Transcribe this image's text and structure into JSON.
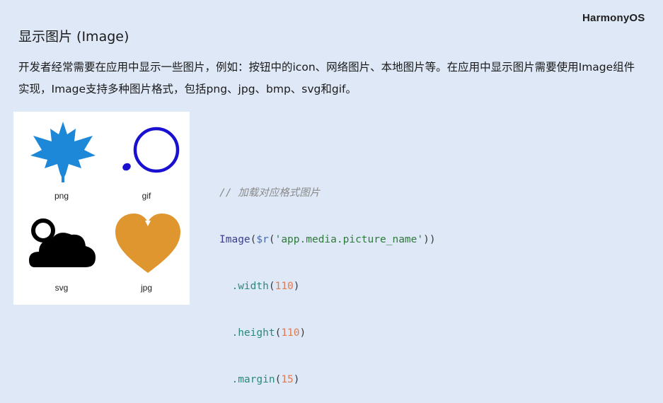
{
  "brand": "HarmonyOS",
  "title": "显示图片 (Image)",
  "description": "开发者经常需要在应用中显示一些图片，例如：按钮中的icon、网络图片、本地图片等。在应用中显示图片需要使用Image组件实现，Image支持多种图片格式，包括png、jpg、bmp、svg和gif。",
  "images": [
    {
      "label": "png",
      "icon": "maple-leaf-icon",
      "color": "#1e88d8"
    },
    {
      "label": "gif",
      "icon": "loading-circle-icon",
      "color": "#1a10d0"
    },
    {
      "label": "svg",
      "icon": "cloud-icon",
      "color": "#000000"
    },
    {
      "label": "jpg",
      "icon": "heart-icon",
      "color": "#e0962f"
    }
  ],
  "code": {
    "comment": "// 加载对应格式图片",
    "line1_ident": "Image",
    "line1_open": "(",
    "line1_fn": "$r",
    "line1_open2": "(",
    "line1_str": "'app.media.picture_name'",
    "line1_close": "))",
    "width_method": ".width",
    "width_value": "110",
    "height_method": ".height",
    "height_value": "110",
    "margin_method": ".margin",
    "margin_value": "15"
  }
}
